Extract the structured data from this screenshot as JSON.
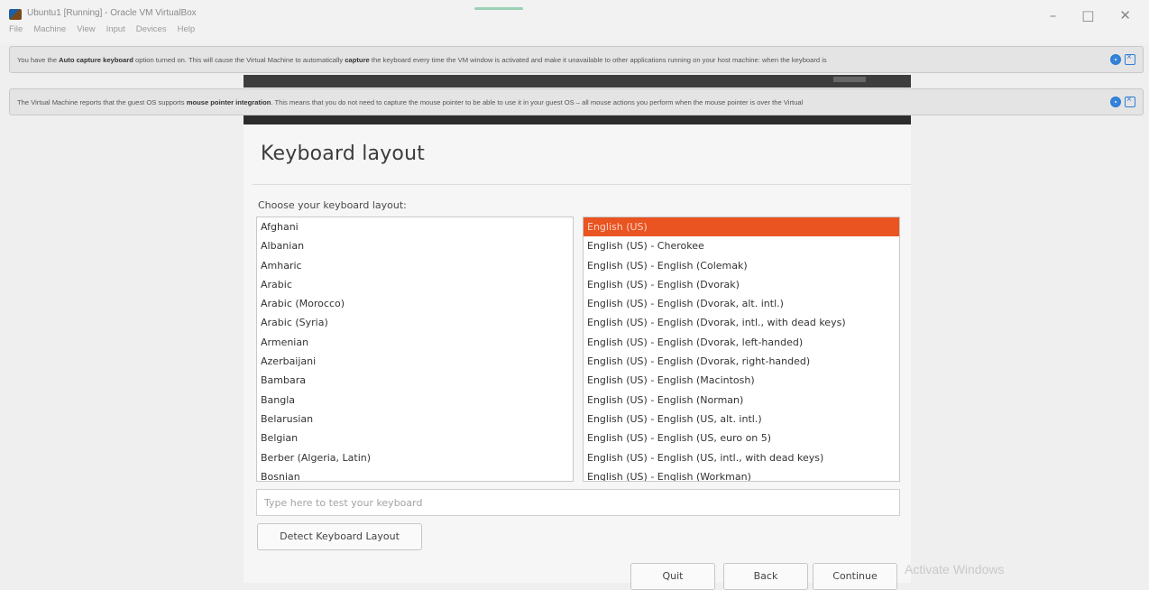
{
  "window": {
    "title": "Ubuntu1 [Running] - Oracle VM VirtualBox",
    "menu": [
      "File",
      "Machine",
      "View",
      "Input",
      "Devices",
      "Help"
    ],
    "controls": {
      "minimize": "–",
      "maximize": "□",
      "close": "✕"
    }
  },
  "notifications": [
    {
      "before": "You have the ",
      "bold1": "Auto capture keyboard",
      "middle": " option turned on. This will cause the Virtual Machine to automatically ",
      "bold2": "capture",
      "after": " the keyboard every time the VM window is activated and make it unavailable to other applications running on your host machine: when the keyboard is"
    },
    {
      "before": "The Virtual Machine reports that the guest OS supports ",
      "bold1": "mouse pointer integration",
      "middle": ". This means that you do not need to ",
      "bold2": "",
      "after": "capture the mouse pointer to be able to use it in your guest OS – all mouse actions you perform when the mouse pointer is over the Virtual"
    }
  ],
  "installer": {
    "title": "Keyboard layout",
    "choose_label": "Choose your keyboard layout:",
    "layouts": [
      "Afghani",
      "Albanian",
      "Amharic",
      "Arabic",
      "Arabic (Morocco)",
      "Arabic (Syria)",
      "Armenian",
      "Azerbaijani",
      "Bambara",
      "Bangla",
      "Belarusian",
      "Belgian",
      "Berber (Algeria, Latin)",
      "Bosnian"
    ],
    "variants": [
      "English (US)",
      "English (US) - Cherokee",
      "English (US) - English (Colemak)",
      "English (US) - English (Dvorak)",
      "English (US) - English (Dvorak, alt. intl.)",
      "English (US) - English (Dvorak, intl., with dead keys)",
      "English (US) - English (Dvorak, left-handed)",
      "English (US) - English (Dvorak, right-handed)",
      "English (US) - English (Macintosh)",
      "English (US) - English (Norman)",
      "English (US) - English (US, alt. intl.)",
      "English (US) - English (US, euro on 5)",
      "English (US) - English (US, intl., with dead keys)",
      "English (US) - English (Workman)"
    ],
    "selected_variant": "English (US)",
    "test_placeholder": "Type here to test your keyboard",
    "detect_label": "Detect Keyboard Layout",
    "quit_label": "Quit",
    "back_label": "Back",
    "continue_label": "Continue"
  },
  "watermark": "Activate Windows",
  "colors": {
    "selection": "#e95420",
    "info_icon": "#2f7fd6"
  }
}
